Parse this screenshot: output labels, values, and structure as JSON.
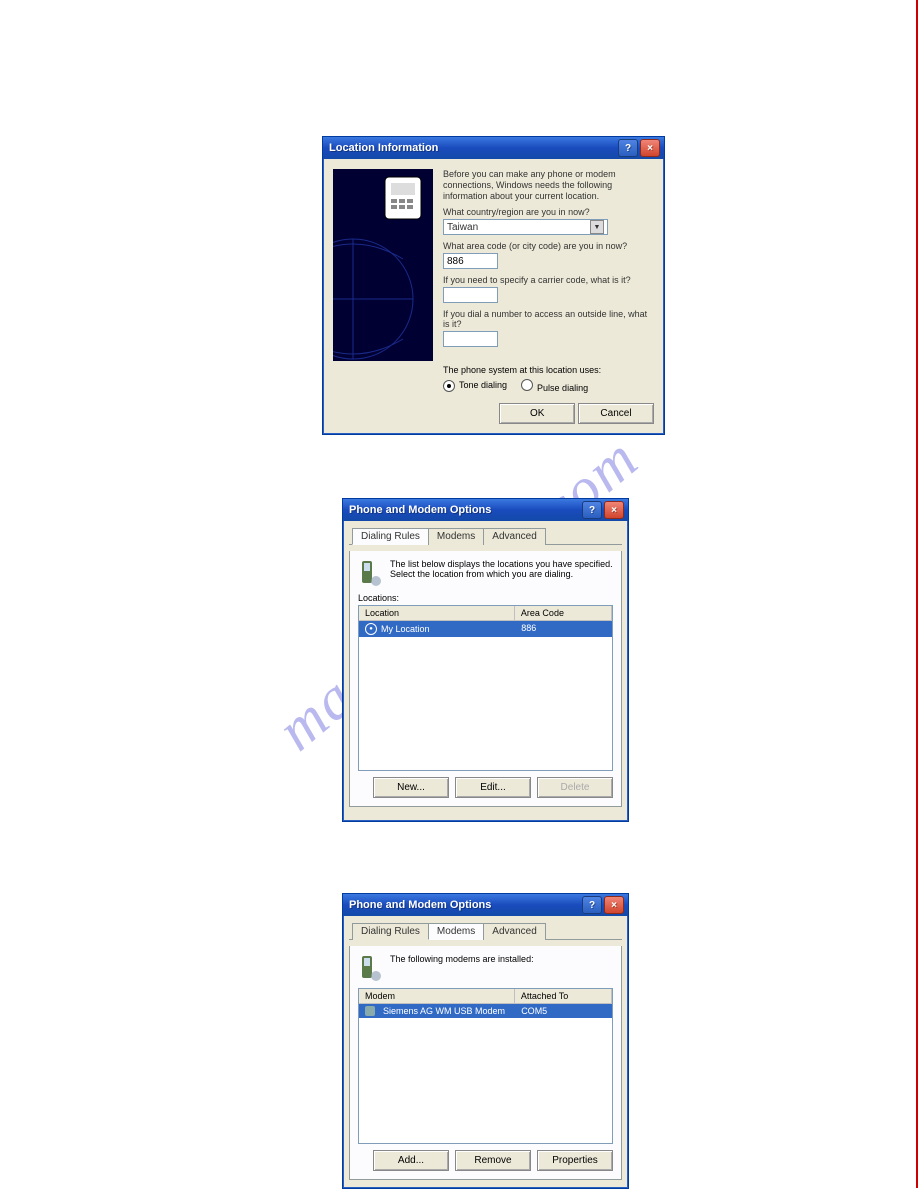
{
  "watermark": "manualshive.com",
  "dlg1": {
    "title": "Location Information",
    "intro": "Before you can make any phone or modem connections, Windows needs the following information about your current location.",
    "q_country": "What country/region are you in now?",
    "country_value": "Taiwan",
    "q_area": "What area code (or city code) are you in now?",
    "area_value": "886",
    "q_carrier": "If you need to specify a carrier code, what is it?",
    "carrier_value": "",
    "q_outside": "If you dial a number to access an outside line, what is it?",
    "outside_value": "",
    "phone_system_label": "The phone system at this location uses:",
    "tone_label": "Tone dialing",
    "pulse_label": "Pulse dialing",
    "ok": "OK",
    "cancel": "Cancel"
  },
  "dlg2": {
    "title": "Phone and Modem Options",
    "tabs": {
      "dialing": "Dialing Rules",
      "modems": "Modems",
      "advanced": "Advanced"
    },
    "desc": "The list below displays the locations you have specified. Select the location from which you are dialing.",
    "locations_label": "Locations:",
    "col_location": "Location",
    "col_area": "Area Code",
    "row_location": "My Location",
    "row_area": "886",
    "new_btn": "New...",
    "edit_btn": "Edit...",
    "delete_btn": "Delete"
  },
  "dlg3": {
    "title": "Phone and Modem Options",
    "tabs": {
      "dialing": "Dialing Rules",
      "modems": "Modems",
      "advanced": "Advanced"
    },
    "desc": "The following modems are installed:",
    "col_modem": "Modem",
    "col_attached": "Attached To",
    "row_modem": "Siemens AG WM USB Modem",
    "row_port": "COM5",
    "add_btn": "Add...",
    "remove_btn": "Remove",
    "props_btn": "Properties"
  }
}
